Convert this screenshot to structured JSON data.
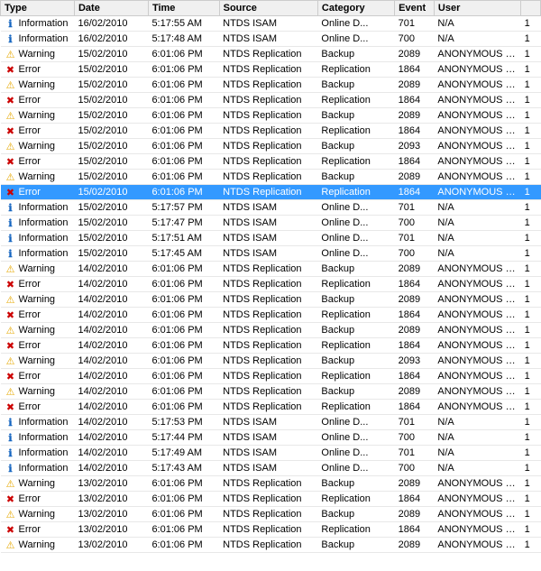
{
  "columns": [
    "Type",
    "Date",
    "Time",
    "Source",
    "Category",
    "Event",
    "User",
    ""
  ],
  "rows": [
    {
      "type": "Information",
      "date": "16/02/2010",
      "time": "5:17:55 AM",
      "source": "NTDS ISAM",
      "category": "Online D...",
      "event": "701",
      "user": "N/A",
      "num": "1"
    },
    {
      "type": "Information",
      "date": "16/02/2010",
      "time": "5:17:48 AM",
      "source": "NTDS ISAM",
      "category": "Online D...",
      "event": "700",
      "user": "N/A",
      "num": "1"
    },
    {
      "type": "Warning",
      "date": "15/02/2010",
      "time": "6:01:06 PM",
      "source": "NTDS Replication",
      "category": "Backup",
      "event": "2089",
      "user": "ANONYMOUS L...",
      "num": "1"
    },
    {
      "type": "Error",
      "date": "15/02/2010",
      "time": "6:01:06 PM",
      "source": "NTDS Replication",
      "category": "Replication",
      "event": "1864",
      "user": "ANONYMOUS L...",
      "num": "1"
    },
    {
      "type": "Warning",
      "date": "15/02/2010",
      "time": "6:01:06 PM",
      "source": "NTDS Replication",
      "category": "Backup",
      "event": "2089",
      "user": "ANONYMOUS L...",
      "num": "1"
    },
    {
      "type": "Error",
      "date": "15/02/2010",
      "time": "6:01:06 PM",
      "source": "NTDS Replication",
      "category": "Replication",
      "event": "1864",
      "user": "ANONYMOUS L...",
      "num": "1"
    },
    {
      "type": "Warning",
      "date": "15/02/2010",
      "time": "6:01:06 PM",
      "source": "NTDS Replication",
      "category": "Backup",
      "event": "2089",
      "user": "ANONYMOUS L...",
      "num": "1"
    },
    {
      "type": "Error",
      "date": "15/02/2010",
      "time": "6:01:06 PM",
      "source": "NTDS Replication",
      "category": "Replication",
      "event": "1864",
      "user": "ANONYMOUS L...",
      "num": "1"
    },
    {
      "type": "Warning",
      "date": "15/02/2010",
      "time": "6:01:06 PM",
      "source": "NTDS Replication",
      "category": "Backup",
      "event": "2093",
      "user": "ANONYMOUS L...",
      "num": "1"
    },
    {
      "type": "Error",
      "date": "15/02/2010",
      "time": "6:01:06 PM",
      "source": "NTDS Replication",
      "category": "Replication",
      "event": "1864",
      "user": "ANONYMOUS L...",
      "num": "1"
    },
    {
      "type": "Warning",
      "date": "15/02/2010",
      "time": "6:01:06 PM",
      "source": "NTDS Replication",
      "category": "Backup",
      "event": "2089",
      "user": "ANONYMOUS L...",
      "num": "1"
    },
    {
      "type": "Error",
      "date": "15/02/2010",
      "time": "6:01:06 PM",
      "source": "NTDS Replication",
      "category": "Replication",
      "event": "1864",
      "user": "ANONYMOUS L...",
      "num": "1",
      "selected": true
    },
    {
      "type": "Information",
      "date": "15/02/2010",
      "time": "5:17:57 PM",
      "source": "NTDS ISAM",
      "category": "Online D...",
      "event": "701",
      "user": "N/A",
      "num": "1"
    },
    {
      "type": "Information",
      "date": "15/02/2010",
      "time": "5:17:47 PM",
      "source": "NTDS ISAM",
      "category": "Online D...",
      "event": "700",
      "user": "N/A",
      "num": "1"
    },
    {
      "type": "Information",
      "date": "15/02/2010",
      "time": "5:17:51 AM",
      "source": "NTDS ISAM",
      "category": "Online D...",
      "event": "701",
      "user": "N/A",
      "num": "1"
    },
    {
      "type": "Information",
      "date": "15/02/2010",
      "time": "5:17:45 AM",
      "source": "NTDS ISAM",
      "category": "Online D...",
      "event": "700",
      "user": "N/A",
      "num": "1"
    },
    {
      "type": "Warning",
      "date": "14/02/2010",
      "time": "6:01:06 PM",
      "source": "NTDS Replication",
      "category": "Backup",
      "event": "2089",
      "user": "ANONYMOUS L...",
      "num": "1"
    },
    {
      "type": "Error",
      "date": "14/02/2010",
      "time": "6:01:06 PM",
      "source": "NTDS Replication",
      "category": "Replication",
      "event": "1864",
      "user": "ANONYMOUS L...",
      "num": "1"
    },
    {
      "type": "Warning",
      "date": "14/02/2010",
      "time": "6:01:06 PM",
      "source": "NTDS Replication",
      "category": "Backup",
      "event": "2089",
      "user": "ANONYMOUS L...",
      "num": "1"
    },
    {
      "type": "Error",
      "date": "14/02/2010",
      "time": "6:01:06 PM",
      "source": "NTDS Replication",
      "category": "Replication",
      "event": "1864",
      "user": "ANONYMOUS L...",
      "num": "1"
    },
    {
      "type": "Warning",
      "date": "14/02/2010",
      "time": "6:01:06 PM",
      "source": "NTDS Replication",
      "category": "Backup",
      "event": "2089",
      "user": "ANONYMOUS L...",
      "num": "1"
    },
    {
      "type": "Error",
      "date": "14/02/2010",
      "time": "6:01:06 PM",
      "source": "NTDS Replication",
      "category": "Replication",
      "event": "1864",
      "user": "ANONYMOUS L...",
      "num": "1"
    },
    {
      "type": "Warning",
      "date": "14/02/2010",
      "time": "6:01:06 PM",
      "source": "NTDS Replication",
      "category": "Backup",
      "event": "2093",
      "user": "ANONYMOUS L...",
      "num": "1"
    },
    {
      "type": "Error",
      "date": "14/02/2010",
      "time": "6:01:06 PM",
      "source": "NTDS Replication",
      "category": "Replication",
      "event": "1864",
      "user": "ANONYMOUS L...",
      "num": "1"
    },
    {
      "type": "Warning",
      "date": "14/02/2010",
      "time": "6:01:06 PM",
      "source": "NTDS Replication",
      "category": "Backup",
      "event": "2089",
      "user": "ANONYMOUS L...",
      "num": "1"
    },
    {
      "type": "Error",
      "date": "14/02/2010",
      "time": "6:01:06 PM",
      "source": "NTDS Replication",
      "category": "Replication",
      "event": "1864",
      "user": "ANONYMOUS L...",
      "num": "1"
    },
    {
      "type": "Information",
      "date": "14/02/2010",
      "time": "5:17:53 PM",
      "source": "NTDS ISAM",
      "category": "Online D...",
      "event": "701",
      "user": "N/A",
      "num": "1"
    },
    {
      "type": "Information",
      "date": "14/02/2010",
      "time": "5:17:44 PM",
      "source": "NTDS ISAM",
      "category": "Online D...",
      "event": "700",
      "user": "N/A",
      "num": "1"
    },
    {
      "type": "Information",
      "date": "14/02/2010",
      "time": "5:17:49 AM",
      "source": "NTDS ISAM",
      "category": "Online D...",
      "event": "701",
      "user": "N/A",
      "num": "1"
    },
    {
      "type": "Information",
      "date": "14/02/2010",
      "time": "5:17:43 AM",
      "source": "NTDS ISAM",
      "category": "Online D...",
      "event": "700",
      "user": "N/A",
      "num": "1"
    },
    {
      "type": "Warning",
      "date": "13/02/2010",
      "time": "6:01:06 PM",
      "source": "NTDS Replication",
      "category": "Backup",
      "event": "2089",
      "user": "ANONYMOUS L...",
      "num": "1"
    },
    {
      "type": "Error",
      "date": "13/02/2010",
      "time": "6:01:06 PM",
      "source": "NTDS Replication",
      "category": "Replication",
      "event": "1864",
      "user": "ANONYMOUS L...",
      "num": "1"
    },
    {
      "type": "Warning",
      "date": "13/02/2010",
      "time": "6:01:06 PM",
      "source": "NTDS Replication",
      "category": "Backup",
      "event": "2089",
      "user": "ANONYMOUS L...",
      "num": "1"
    },
    {
      "type": "Error",
      "date": "13/02/2010",
      "time": "6:01:06 PM",
      "source": "NTDS Replication",
      "category": "Replication",
      "event": "1864",
      "user": "ANONYMOUS L...",
      "num": "1"
    },
    {
      "type": "Warning",
      "date": "13/02/2010",
      "time": "6:01:06 PM",
      "source": "NTDS Replication",
      "category": "Backup",
      "event": "2089",
      "user": "ANONYMOUS L...",
      "num": "1"
    }
  ]
}
